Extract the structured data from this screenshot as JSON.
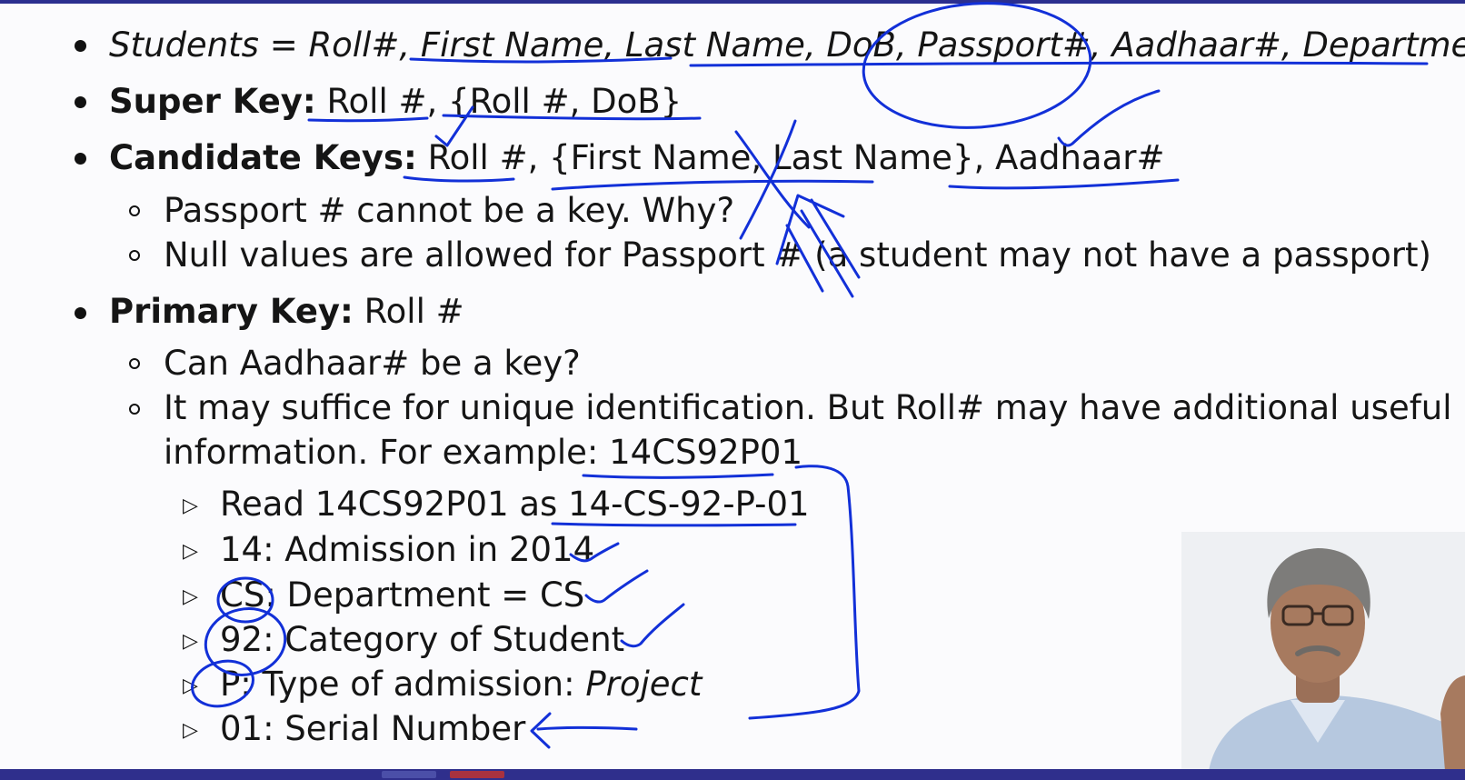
{
  "slide": {
    "bullets": {
      "students_def": "Students = Roll#, First Name, Last Name, DoB, Passport#, Aadhaar#, Department",
      "super_key_label": "Super Key:",
      "super_key_value": "Roll #, {Roll #, DoB}",
      "candidate_keys_label": "Candidate Keys:",
      "candidate_keys_value": "Roll #, {First Name, Last Name}, Aadhaar#",
      "passport_sub1": "Passport # cannot be a key. Why?",
      "passport_sub2": "Null values are allowed for Passport # (a student may not have a passport)",
      "primary_key_label": "Primary Key:",
      "primary_key_value": "Roll #",
      "pk_sub1": "Can Aadhaar# be a key?",
      "pk_sub2_line1": "It may suffice for unique identification. But Roll# may have additional useful",
      "pk_sub2_line2": "information. For example: 14CS92P01",
      "roll_items": [
        {
          "text": "Read 14CS92P01 as 14-CS-92-P-01"
        },
        {
          "text": "14: Admission in 2014"
        },
        {
          "text": "CS: Department = CS"
        },
        {
          "text": "92: Category of Student"
        },
        {
          "text": "P: Type of admission: ",
          "italic": "Project"
        },
        {
          "text": "01: Serial Number"
        }
      ]
    }
  },
  "annotation_color": "#1230d8",
  "icons": {
    "speaker": "lecturer-video-overlay"
  }
}
